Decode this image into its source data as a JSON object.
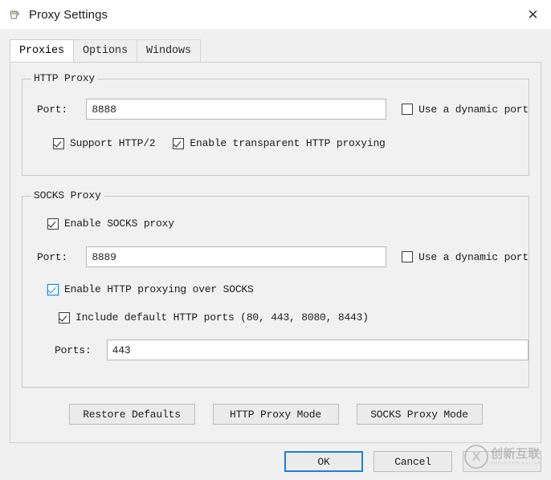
{
  "window": {
    "title": "Proxy Settings",
    "icon": "charles-proxy-app-icon",
    "close_label": "✕"
  },
  "tabs": [
    {
      "label": "Proxies",
      "active": true
    },
    {
      "label": "Options",
      "active": false
    },
    {
      "label": "Windows",
      "active": false
    }
  ],
  "http_proxy": {
    "group_title": "HTTP Proxy",
    "port_label": "Port:",
    "port_value": "8888",
    "dynamic_port": {
      "label": "Use a dynamic port",
      "checked": false
    },
    "support_http2": {
      "label": "Support HTTP/2",
      "checked": true
    },
    "transparent_proxying": {
      "label": "Enable transparent HTTP proxying",
      "checked": true
    }
  },
  "socks_proxy": {
    "group_title": "SOCKS Proxy",
    "enable_socks": {
      "label": "Enable SOCKS proxy",
      "checked": true
    },
    "port_label": "Port:",
    "port_value": "8889",
    "dynamic_port": {
      "label": "Use a dynamic port",
      "checked": false
    },
    "http_over_socks": {
      "label": "Enable HTTP proxying over SOCKS",
      "checked": true,
      "focused": true
    },
    "include_default_ports": {
      "label": "Include default HTTP ports (80, 443, 8080, 8443)",
      "checked": true
    },
    "ports_label": "Ports:",
    "ports_value": "443"
  },
  "mode_buttons": {
    "restore_defaults": "Restore Defaults",
    "http_proxy_mode": "HTTP Proxy Mode",
    "socks_proxy_mode": "SOCKS Proxy Mode"
  },
  "footer": {
    "ok": "OK",
    "cancel": "Cancel",
    "extra": ""
  },
  "watermark": {
    "cn_text": "创新互联",
    "en_text": "CHUANGXIN HULIAN",
    "mark": "cx-circle-logo"
  },
  "colors": {
    "accent": "#1f7fd0",
    "focus_blue": "#1f8ae0",
    "panel_bg": "#f1f1f1",
    "titlebar_bg": "#ffffff",
    "field_bg": "#ffffff"
  }
}
